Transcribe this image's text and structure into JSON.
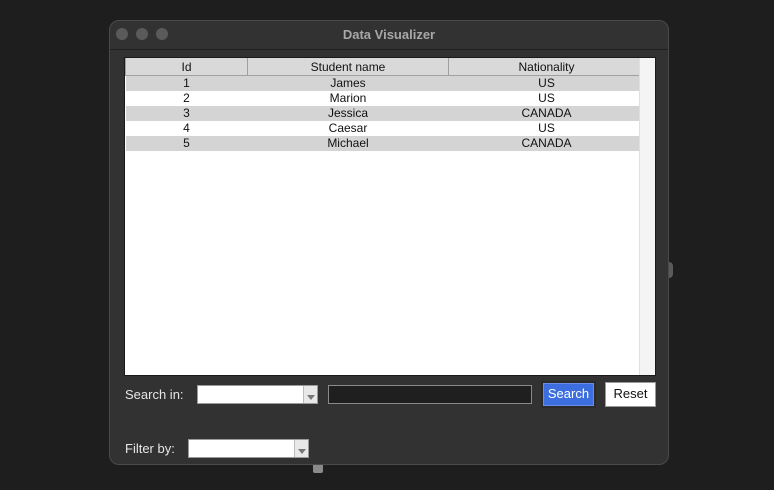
{
  "window": {
    "title": "Data Visualizer"
  },
  "table": {
    "columns": [
      "Id",
      "Student name",
      "Nationality"
    ],
    "rows": [
      [
        "1",
        "James",
        "US"
      ],
      [
        "2",
        "Marion",
        "US"
      ],
      [
        "3",
        "Jessica",
        "CANADA"
      ],
      [
        "4",
        "Caesar",
        "US"
      ],
      [
        "5",
        "Michael",
        "CANADA"
      ]
    ]
  },
  "search": {
    "label": "Search in:",
    "column_selected": "",
    "query_value": "",
    "search_button": "Search",
    "reset_button": "Reset"
  },
  "filter": {
    "label": "Filter by:",
    "selected": ""
  },
  "colors": {
    "window_bg": "#323232",
    "accent_button": "#3d6ee0",
    "row_stripe": "#d4d4d4"
  }
}
